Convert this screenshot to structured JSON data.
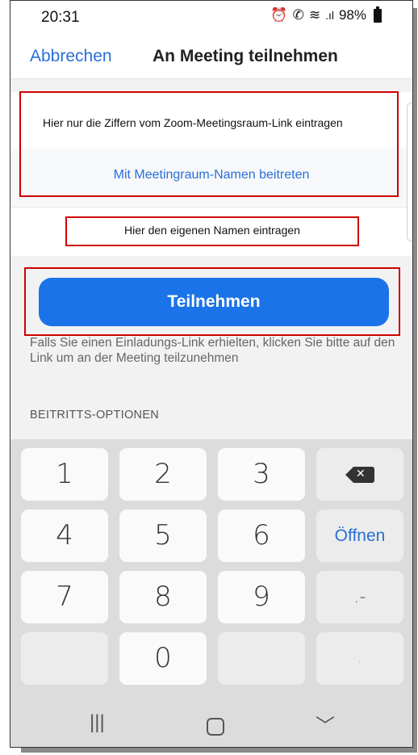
{
  "status_bar": {
    "time": "20:31",
    "icons": [
      "alarm-icon",
      "wifi-calling-icon",
      "wifi-icon",
      "signal-icon"
    ],
    "battery": "98%"
  },
  "header": {
    "cancel_label": "Abbrechen",
    "title": "An Meeting teilnehmen"
  },
  "meeting_id": {
    "placeholder": "Hier nur die Ziffern vom Zoom-Meetingsraum-Link eintragen",
    "value": ""
  },
  "join_by_name_label": "Mit Meetingraum-Namen beitreten",
  "display_name": {
    "placeholder": "Hier den eigenen Namen eintragen",
    "value": ""
  },
  "join_button_label": "Teilnehmen",
  "info_text": "Falls Sie einen Einladungs-Link erhielten, klicken Sie bitte auf den Link um an der Meeting teilzunehmen",
  "options_header": "BEITRITTS-OPTIONEN",
  "keyboard": {
    "keys": [
      "1",
      "2",
      "3",
      "4",
      "5",
      "6",
      "7",
      "8",
      "9",
      "0"
    ],
    "open_label": "Öffnen",
    "dot_dash": ".-",
    "comma": ","
  },
  "colors": {
    "accent": "#1a73e8",
    "link": "#2a6fd6",
    "annotation": "#d00000"
  }
}
